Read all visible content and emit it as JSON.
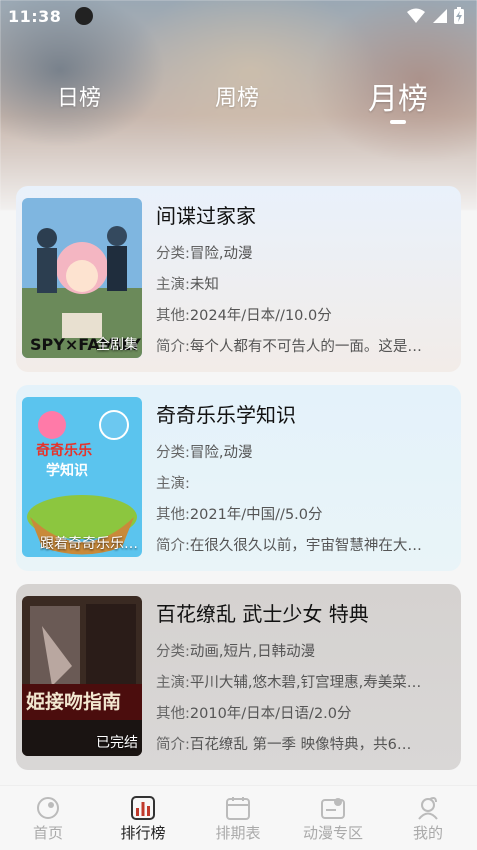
{
  "status": {
    "time": "11:38"
  },
  "tabs": [
    {
      "label": "日榜"
    },
    {
      "label": "周榜"
    },
    {
      "label": "月榜"
    }
  ],
  "items": [
    {
      "title": "间谍过家家",
      "category_key": "分类:",
      "category": "冒险,动漫",
      "cast_key": "主演:",
      "cast": "未知",
      "other_key": "其他:",
      "other": "2024年/日本//10.0分",
      "intro_key": "简介:",
      "intro": "每个人都有不可告人的一面。这是…",
      "badge": "全剧集",
      "poster_text": "SPY×FAMILY"
    },
    {
      "title": "奇奇乐乐学知识",
      "category_key": "分类:",
      "category": "冒险,动漫",
      "cast_key": "主演:",
      "cast": "",
      "other_key": "其他:",
      "other": "2021年/中国//5.0分",
      "intro_key": "简介:",
      "intro": "在很久很久以前，宇宙智慧神在大…",
      "badge": "跟着奇奇乐乐…",
      "poster_text": "奇奇乐乐学知识"
    },
    {
      "title": "百花缭乱 武士少女 特典",
      "category_key": "分类:",
      "category": "动画,短片,日韩动漫",
      "cast_key": "主演:",
      "cast": "平川大辅,悠木碧,钉宫理惠,寿美菜…",
      "other_key": "其他:",
      "other": "2010年/日本/日语/2.0分",
      "intro_key": "简介:",
      "intro": "百花缭乱 第一季 映像特典，共6…",
      "badge": "已完结",
      "poster_text": "姫接吻指南"
    }
  ],
  "tabbar": [
    {
      "label": "首页",
      "icon": "home-icon"
    },
    {
      "label": "排行榜",
      "icon": "ranking-icon"
    },
    {
      "label": "排期表",
      "icon": "calendar-icon"
    },
    {
      "label": "动漫专区",
      "icon": "anime-zone-icon"
    },
    {
      "label": "我的",
      "icon": "profile-icon"
    }
  ],
  "colors": {
    "accent": "#c0392b",
    "tab_active": "#222222",
    "tab_inactive": "#aaaaaa"
  }
}
